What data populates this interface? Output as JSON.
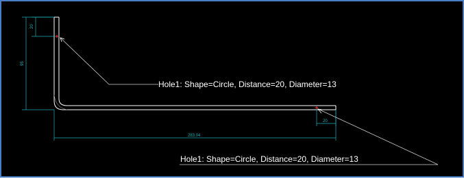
{
  "drawing": {
    "background": "#000000",
    "frame_color": "#4a7fc6",
    "part_color": "#ffffff",
    "dimension_color": "#1fb0b8",
    "leader_color": "#cfcfcf",
    "hole_mark_color": "#ff3030",
    "dimensions": {
      "top_hole_offset": "20",
      "vertical_height": "95",
      "horizontal_length": "283.04",
      "right_hole_offset": "20"
    },
    "callouts": {
      "top_hole": "Hole1: Shape=Circle, Distance=20, Diameter=13",
      "right_hole": "Hole1: Shape=Circle, Distance=20, Diameter=13"
    }
  }
}
